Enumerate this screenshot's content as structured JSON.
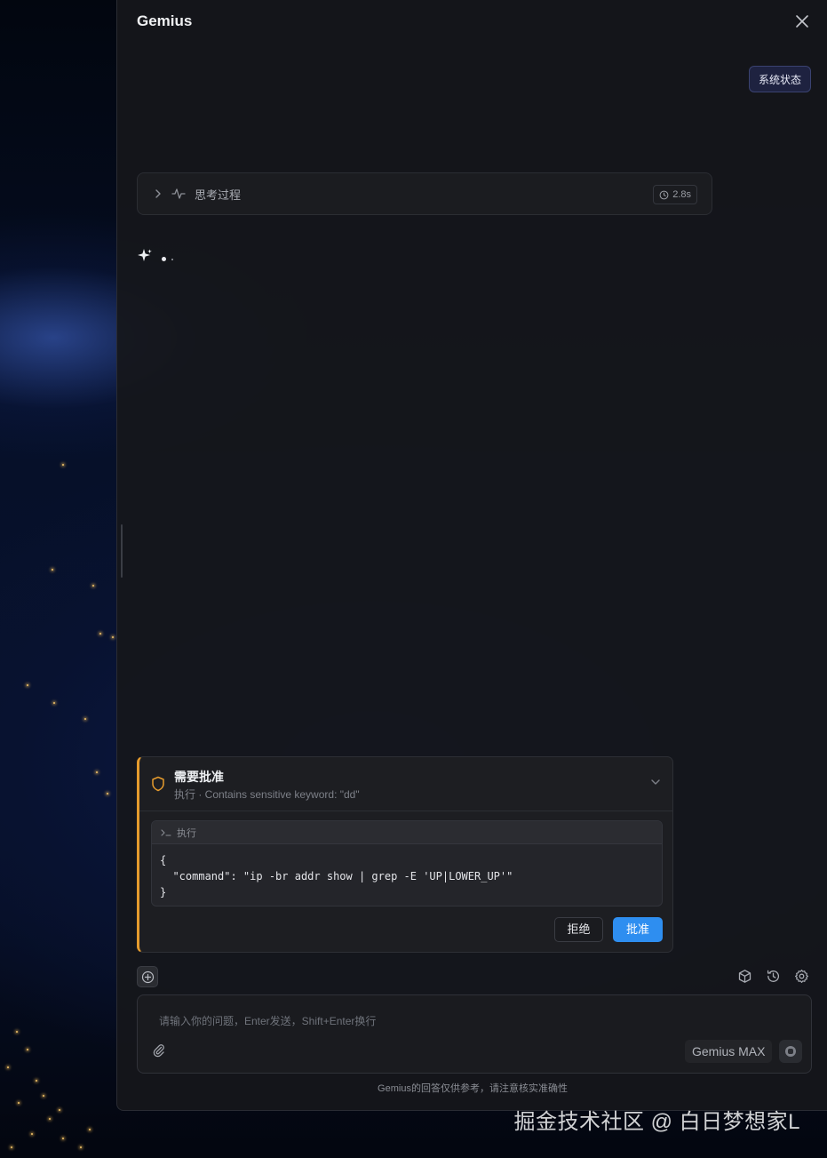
{
  "window": {
    "title": "Gemius"
  },
  "header": {
    "status_button": "系统状态"
  },
  "thinking": {
    "label": "思考过程",
    "duration": "2.8s"
  },
  "approval": {
    "title": "需要批准",
    "subtitle": "执行 · Contains sensitive keyword: \"dd\"",
    "code_header": "执行",
    "code": "{\n  \"command\": \"ip -br addr show | grep -E 'UP|LOWER_UP'\"\n}",
    "reject_label": "拒绝",
    "approve_label": "批准",
    "accent_color": "#e59b2d"
  },
  "composer": {
    "placeholder": "请输入你的问题，Enter发送，Shift+Enter换行",
    "model": "Gemius MAX"
  },
  "footer": {
    "disclaimer": "Gemius的回答仅供参考，请注意核实准确性"
  },
  "watermark": "掘金技术社区 @ 白日梦想家L",
  "icons": {
    "close": "close-icon",
    "chevron": "chevron-right-icon",
    "activity": "activity-icon",
    "clock": "clock-icon",
    "sparkle": "sparkle-icon",
    "shield": "shield-icon",
    "terminal": "terminal-icon",
    "plus": "plus-circle-icon",
    "cube": "cube-icon",
    "history": "history-icon",
    "gear": "gear-icon",
    "attach": "paperclip-icon",
    "stop": "stop-icon"
  },
  "colors": {
    "approve": "#2e8ef0",
    "status_button": "#1e2240"
  }
}
